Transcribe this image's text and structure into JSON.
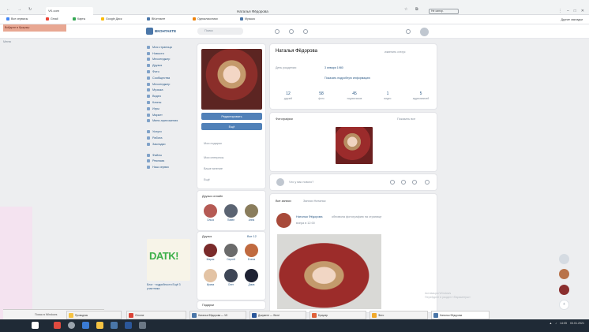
{
  "browser": {
    "tab_title": "VK.com",
    "window_title": "Наталья Фёдорова",
    "profile_chip": "Не синхр.",
    "bookmarks": [
      {
        "label": "Все сервисы",
        "color": "#4285f4"
      },
      {
        "label": "Gmail",
        "color": "#ea4335"
      },
      {
        "label": "Карты",
        "color": "#34a853"
      },
      {
        "label": "Google Диск",
        "color": "#fbbc05"
      },
      {
        "label": "ВКонтакте",
        "color": "#4a76a8"
      },
      {
        "label": "Одноклассники",
        "color": "#ee8208"
      },
      {
        "label": "Музыка",
        "color": "#4a76a8"
      }
    ],
    "bookmarks_right": "Другие закладки",
    "banner": "Войдите в браузер"
  },
  "vk": {
    "logo": "ВКОНТАКТЕ",
    "search_placeholder": "Поиск",
    "left_item": "Меню",
    "nav": [
      "Моя страница",
      "Новости",
      "Мессенджер",
      "Друзья",
      "Фото",
      "Сообщества",
      "Мессенджер",
      "Музыка",
      "Видео",
      "Клипы",
      "Игры",
      "Маркет",
      "Мини-приложения",
      "Услуги",
      "Работа",
      "Закладки",
      "Файлы",
      "Реклама",
      "Наш сервис"
    ],
    "promo_text": "DATK!",
    "promo_caption": "Блог · подробности Ещё 3 участника"
  },
  "profile": {
    "name": "Наталья Фёдорова",
    "status_link": "изменить статус",
    "edit_button": "Редактировать",
    "more_button": "Ещё",
    "side_links": [
      "Мои подарки",
      "Мои интересы",
      "Ваше мнение",
      "Ещё"
    ],
    "info": [
      {
        "key": "День рождения:",
        "value": "3 января 1980"
      },
      {
        "key": "",
        "value": "Показать подробную информацию"
      }
    ],
    "counters": [
      {
        "num": "12",
        "label": "друзей"
      },
      {
        "num": "58",
        "label": "фото"
      },
      {
        "num": "45",
        "label": "подписчиков"
      },
      {
        "num": "1",
        "label": "видео"
      },
      {
        "num": "5",
        "label": "аудиозаписей"
      }
    ],
    "photos_title": "Фотографии",
    "photos_link": "Показать все",
    "what_new": "Что у вас нового?",
    "wall_tab1": "Все записи",
    "wall_tab2": "Записи Натальи",
    "post_author": "Наталья Фёдорова",
    "post_text": "обновила фотографию на странице",
    "post_time": "вчера в 12:00",
    "friends_title": "Друзья онлайн",
    "friends": [
      {
        "name": "Ольга",
        "color": "#b55a54"
      },
      {
        "name": "Павел",
        "color": "#5b6472"
      },
      {
        "name": "Анна",
        "color": "#8a7d5c"
      }
    ],
    "friends2_title": "Друзья",
    "friends2_link": "Все 12",
    "friends2": [
      {
        "name": "Мария",
        "color": "#7a2b2b"
      },
      {
        "name": "Сергей",
        "color": "#6b6b6b"
      },
      {
        "name": "Елена",
        "color": "#c06a3f"
      },
      {
        "name": "Ирина",
        "color": "#e3c3a4"
      },
      {
        "name": "Олег",
        "color": "#3e4656"
      },
      {
        "name": "Дима",
        "color": "#1e2233"
      }
    ],
    "gifts_title": "Подарки"
  },
  "taskbar": {
    "search": "Поиск в Windows",
    "apps": [
      {
        "label": "Проводник",
        "color": "#f6c343"
      },
      {
        "label": "Chrome",
        "color": "#db4437"
      },
      {
        "label": "Наталья Фёдорова — VK",
        "color": "#4a76a8"
      },
      {
        "label": "Документ — Word",
        "color": "#2b579a"
      },
      {
        "label": "Браузер",
        "color": "#e0623a"
      },
      {
        "label": "Фото",
        "color": "#f1a92b"
      },
      {
        "label": "Наталья Фёдорова",
        "color": "#4a76a8"
      }
    ],
    "time": "14:05",
    "date": "03.01.2021"
  },
  "watermark": [
    "Активация Windows",
    "Перейдите в раздел «Параметры»"
  ]
}
